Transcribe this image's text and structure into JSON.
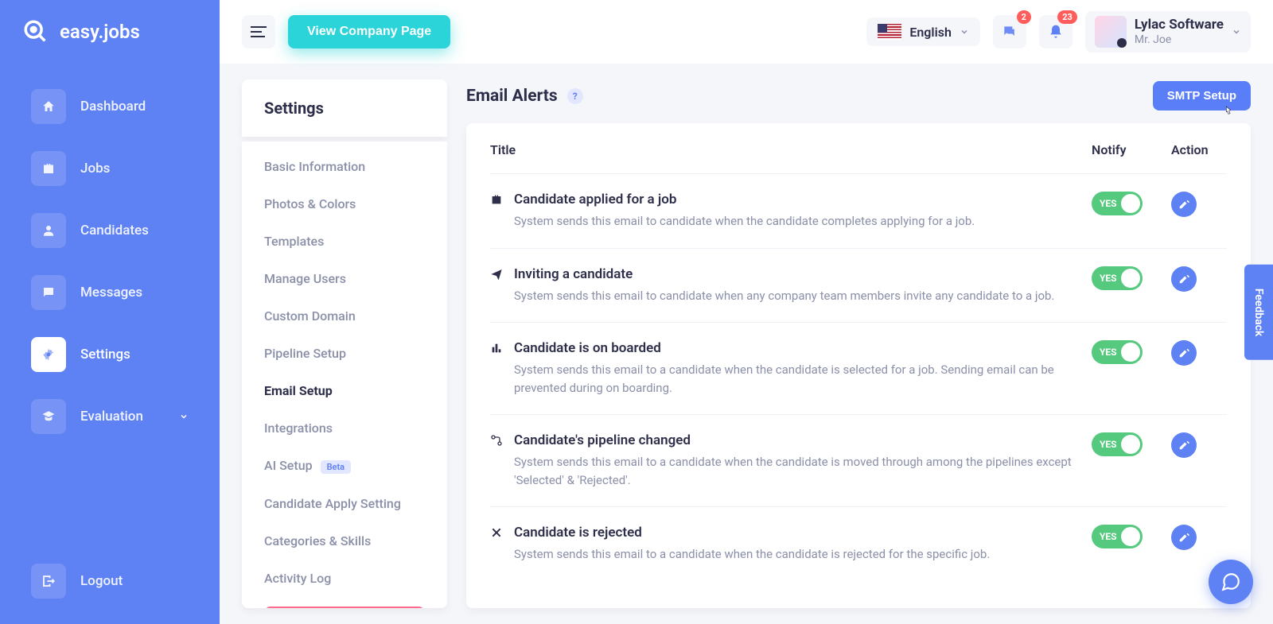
{
  "brand": "easy.jobs",
  "sidebar": {
    "items": [
      {
        "label": "Dashboard",
        "icon": "home"
      },
      {
        "label": "Jobs",
        "icon": "briefcase"
      },
      {
        "label": "Candidates",
        "icon": "user"
      },
      {
        "label": "Messages",
        "icon": "chat"
      },
      {
        "label": "Settings",
        "icon": "gear",
        "active": true
      },
      {
        "label": "Evaluation",
        "icon": "grad-cap",
        "expandable": true
      }
    ],
    "logout": "Logout"
  },
  "topbar": {
    "view_company": "View Company Page",
    "language": "English",
    "badges": {
      "messages": "2",
      "notifications": "23"
    },
    "company": "Lylac Software",
    "user": "Mr. Joe"
  },
  "settings_panel": {
    "title": "Settings",
    "items": [
      "Basic Information",
      "Photos & Colors",
      "Templates",
      "Manage Users",
      "Custom Domain",
      "Pipeline Setup",
      "Email Setup",
      "Integrations",
      "AI Setup",
      "Candidate Apply Setting",
      "Categories & Skills",
      "Activity Log"
    ],
    "active_index": 6,
    "beta_label": "Beta"
  },
  "alerts": {
    "heading": "Email Alerts",
    "smtp_button": "SMTP Setup",
    "columns": {
      "title": "Title",
      "notify": "Notify",
      "action": "Action"
    },
    "toggle_on": "YES",
    "rows": [
      {
        "title": "Candidate applied for a job",
        "desc": "System sends this email to candidate when the candidate completes applying for a job.",
        "notify": true
      },
      {
        "title": "Inviting a candidate",
        "desc": "System sends this email to candidate when any company team members invite any candidate to a job.",
        "notify": true
      },
      {
        "title": "Candidate is on boarded",
        "desc": "System sends this email to a candidate when the candidate is selected for a job. Sending email can be prevented during on boarding.",
        "notify": true
      },
      {
        "title": "Candidate's pipeline changed",
        "desc": "System sends this email to a candidate when the candidate is moved through among the pipelines except 'Selected' & 'Rejected'.",
        "notify": true
      },
      {
        "title": "Candidate is rejected",
        "desc": "System sends this email to a candidate when the candidate is rejected for the specific job.",
        "notify": true
      }
    ]
  },
  "feedback": "Feedback"
}
